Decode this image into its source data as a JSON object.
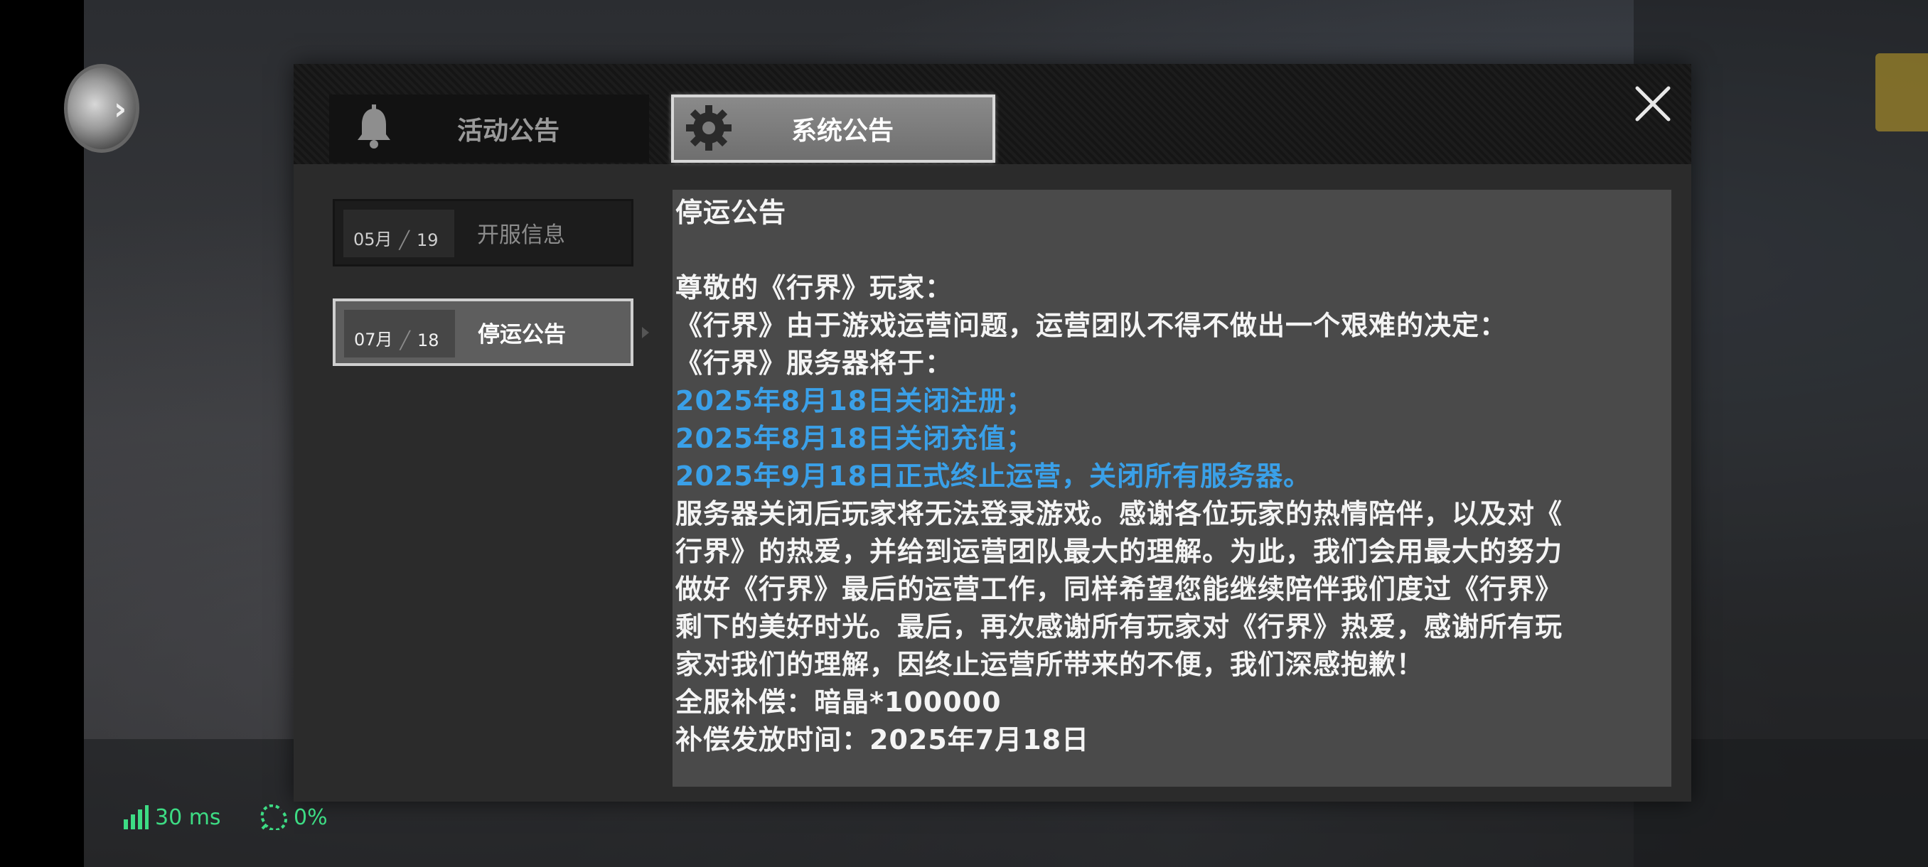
{
  "tabs": [
    {
      "label": "活动公告",
      "icon": "bell-icon",
      "active": false
    },
    {
      "label": "系统公告",
      "icon": "gear-icon",
      "active": true
    }
  ],
  "announcements": [
    {
      "month": "05月",
      "day": "19",
      "title": "开服信息",
      "selected": false
    },
    {
      "month": "07月",
      "day": "18",
      "title": "停运公告",
      "selected": true
    }
  ],
  "content": {
    "lines": [
      {
        "text": "停运公告",
        "style": "normal"
      },
      {
        "text": "",
        "style": "blank"
      },
      {
        "text": "尊敬的《行界》玩家：",
        "style": "normal"
      },
      {
        "text": "《行界》由于游戏运营问题，运营团队不得不做出一个艰难的决定：",
        "style": "normal"
      },
      {
        "text": "《行界》服务器将于：",
        "style": "normal"
      },
      {
        "text": "2025年8月18日关闭注册；",
        "style": "highlight"
      },
      {
        "text": "2025年8月18日关闭充值；",
        "style": "highlight"
      },
      {
        "text": "2025年9月18日正式终止运营，关闭所有服务器。",
        "style": "highlight"
      },
      {
        "text": "服务器关闭后玩家将无法登录游戏。感谢各位玩家的热情陪伴，以及对《",
        "style": "normal"
      },
      {
        "text": "行界》的热爱，并给到运营团队最大的理解。为此，我们会用最大的努力",
        "style": "normal"
      },
      {
        "text": "做好《行界》最后的运营工作，同样希望您能继续陪伴我们度过《行界》",
        "style": "normal"
      },
      {
        "text": "剩下的美好时光。最后，再次感谢所有玩家对《行界》热爱，感谢所有玩",
        "style": "normal"
      },
      {
        "text": "家对我们的理解，因终止运营所带来的不便，我们深感抱歉！",
        "style": "normal"
      },
      {
        "text": "全服补偿：暗晶*100000",
        "style": "normal"
      },
      {
        "text": "补偿发放时间：2025年7月18日",
        "style": "normal"
      }
    ]
  },
  "hud": {
    "ping": "30 ms",
    "loss": "0%"
  },
  "colors": {
    "highlight": "#3aa0e8",
    "hud": "#3ddc84",
    "content_bg": "#4a4a4a"
  }
}
